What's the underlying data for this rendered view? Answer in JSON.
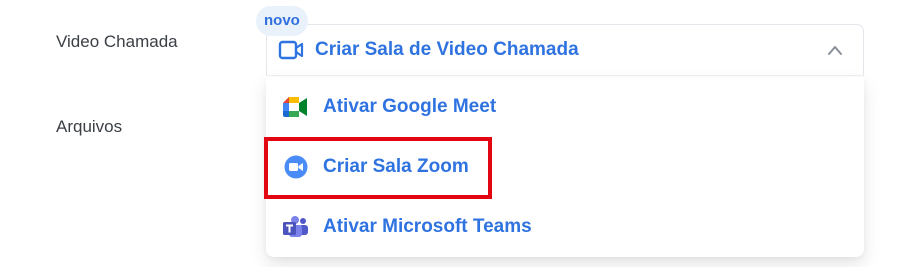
{
  "form": {
    "video_label": "Video Chamada",
    "files_label": "Arquivos"
  },
  "badge": {
    "text": "novo"
  },
  "dropdown": {
    "selected_label": "Criar Sala de Video Chamada",
    "icon": "video-camera-icon",
    "expanded": true
  },
  "menu": {
    "items": [
      {
        "label": "Ativar Google Meet",
        "icon": "google-meet-icon"
      },
      {
        "label": "Criar Sala Zoom",
        "icon": "zoom-icon",
        "highlighted": true
      },
      {
        "label": "Ativar Microsoft Teams",
        "icon": "microsoft-teams-icon"
      }
    ]
  },
  "colors": {
    "accent": "#2f73e0",
    "label": "#3a3f45",
    "highlight": "#e20613",
    "badge_bg": "#e9f1fb"
  }
}
